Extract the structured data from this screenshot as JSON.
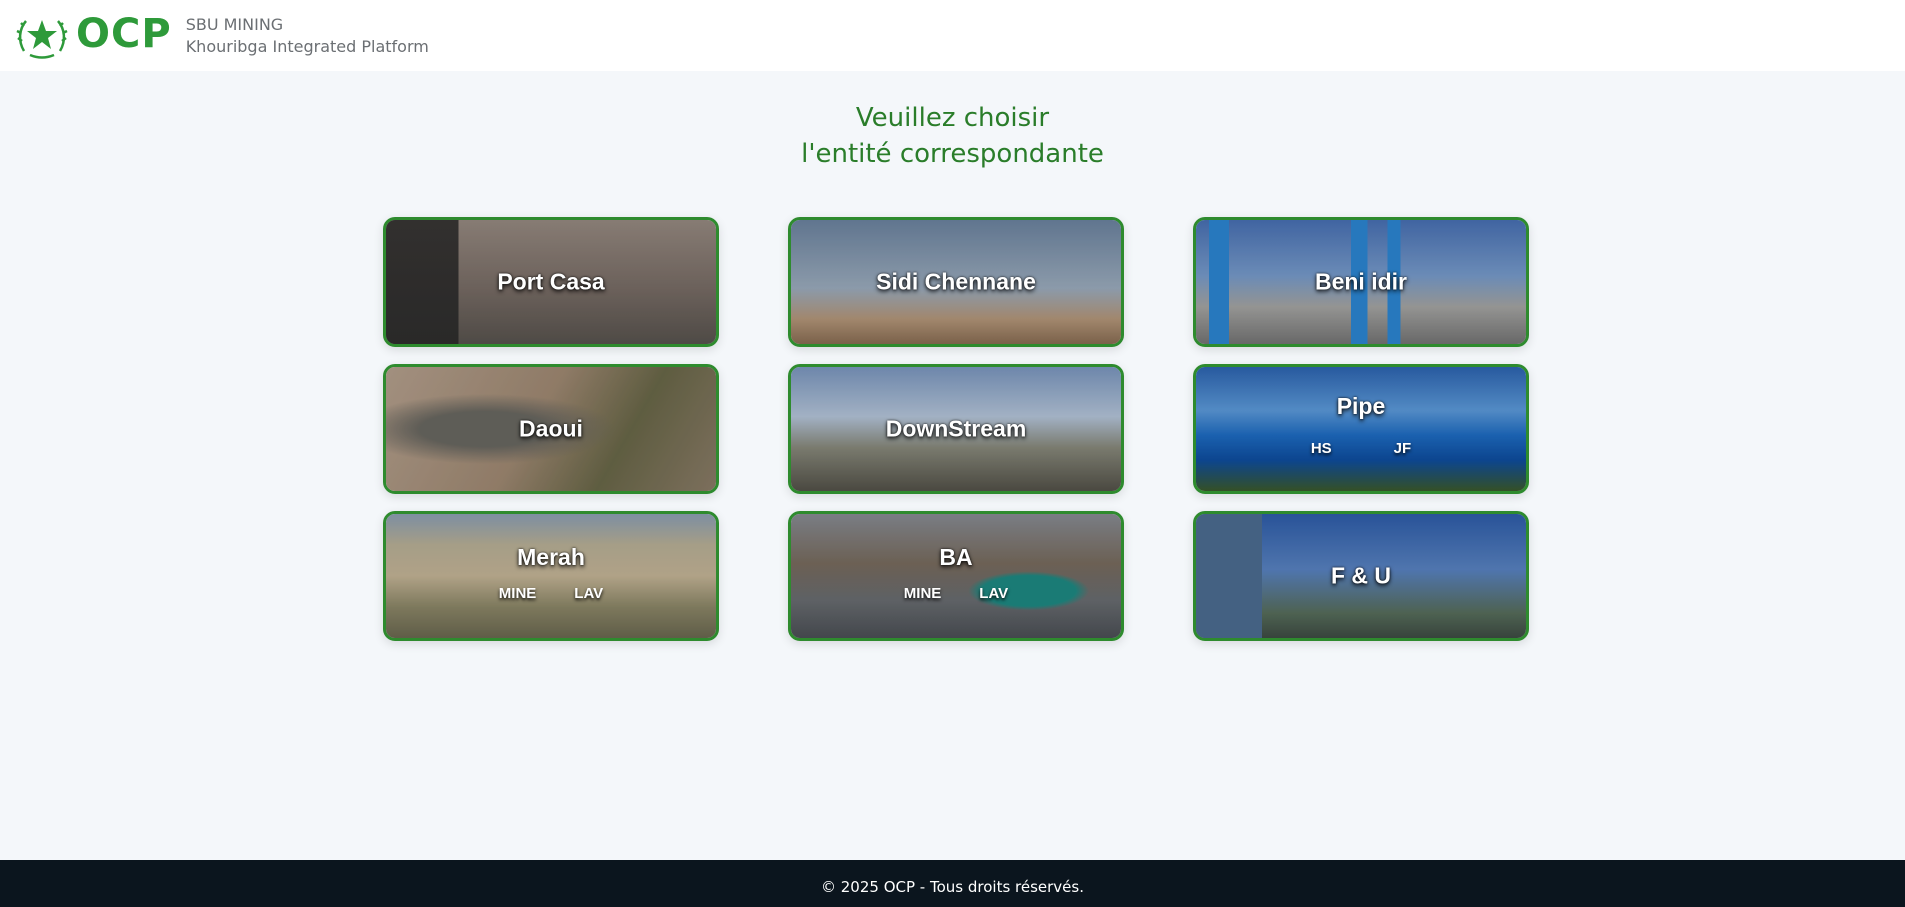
{
  "header": {
    "logo_text": "OCP",
    "brand_line1": "SBU MINING",
    "brand_line2": "Khouribga Integrated Platform"
  },
  "heading": {
    "line1": "Veuillez choisir",
    "line2": "l'entité correspondante"
  },
  "cards": [
    {
      "title": "Port Casa"
    },
    {
      "title": "Sidi Chennane"
    },
    {
      "title": "Beni idir"
    },
    {
      "title": "Daoui"
    },
    {
      "title": "DownStream"
    },
    {
      "title": "Pipe",
      "subs": [
        "HS",
        "JF"
      ]
    },
    {
      "title": "Merah",
      "subs": [
        "MINE",
        "LAV"
      ]
    },
    {
      "title": "BA",
      "subs": [
        "MINE",
        "LAV"
      ]
    },
    {
      "title": "F & U"
    }
  ],
  "footer": {
    "text": "© 2025 OCP - Tous droits réservés."
  },
  "colors": {
    "accent_green": "#2e8b2e",
    "heading_green": "#2a7d2a",
    "footer_bg": "#0b151e",
    "page_bg": "#f4f7fa"
  }
}
